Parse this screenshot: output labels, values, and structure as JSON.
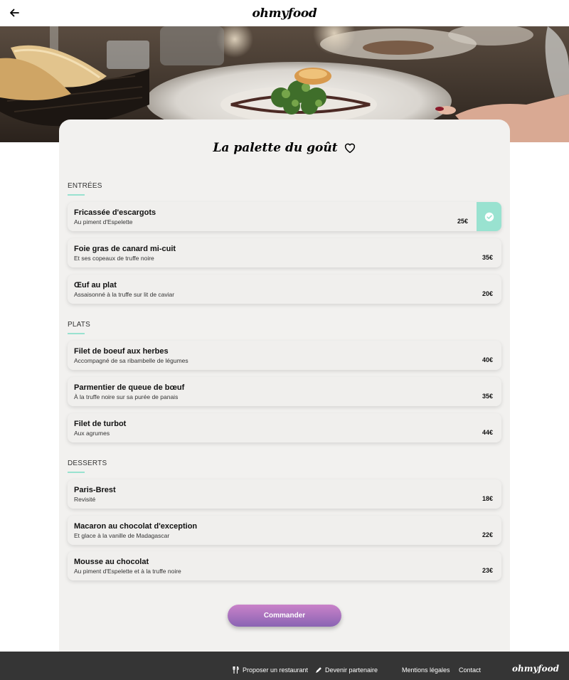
{
  "header": {
    "logo": "ohmyfood"
  },
  "restaurant": {
    "title": "La palette du goût"
  },
  "sections": [
    {
      "title": "ENTRÉES",
      "items": [
        {
          "name": "Fricassée d'escargots",
          "description": "Au piment d'Espelette",
          "price": "25€",
          "selected": true
        },
        {
          "name": "Foie gras de canard mi-cuit",
          "description": "Et ses copeaux de truffe noire",
          "price": "35€"
        },
        {
          "name": "Œuf au plat",
          "description": "Assaisonné à la truffe sur lit de caviar",
          "price": "20€"
        }
      ]
    },
    {
      "title": "PLATS",
      "items": [
        {
          "name": "Filet de boeuf aux herbes",
          "description": "Accompagné de sa ribambelle de légumes",
          "price": "40€"
        },
        {
          "name": "Parmentier de queue de bœuf",
          "description": "À la truffe noire sur sa purée de panais",
          "price": "35€"
        },
        {
          "name": "Filet de turbot",
          "description": "Aux agrumes",
          "price": "44€"
        }
      ]
    },
    {
      "title": "DESSERTS",
      "items": [
        {
          "name": "Paris-Brest",
          "description": "Revisité",
          "price": "18€"
        },
        {
          "name": "Macaron au chocolat d'exception",
          "description": "Et glace à la vanille de Madagascar",
          "price": "22€"
        },
        {
          "name": "Mousse au chocolat",
          "description": "Au piment d'Espelette et à la truffe noire",
          "price": "23€"
        }
      ]
    }
  ],
  "order_button": "Commander",
  "footer": {
    "propose": "Proposer un restaurant",
    "partner": "Devenir partenaire",
    "legal": "Mentions légales",
    "contact": "Contact",
    "logo": "ohmyfood"
  },
  "colors": {
    "accent": "#99e2d0",
    "button_top": "#c982c9",
    "button_bottom": "#8a64b3",
    "footer_bg": "#353535"
  },
  "icons": {
    "back": "arrow-left-icon",
    "favorite": "heart-icon",
    "check": "check-circle-icon",
    "propose": "fork-knife-icon",
    "partner": "pen-icon"
  }
}
